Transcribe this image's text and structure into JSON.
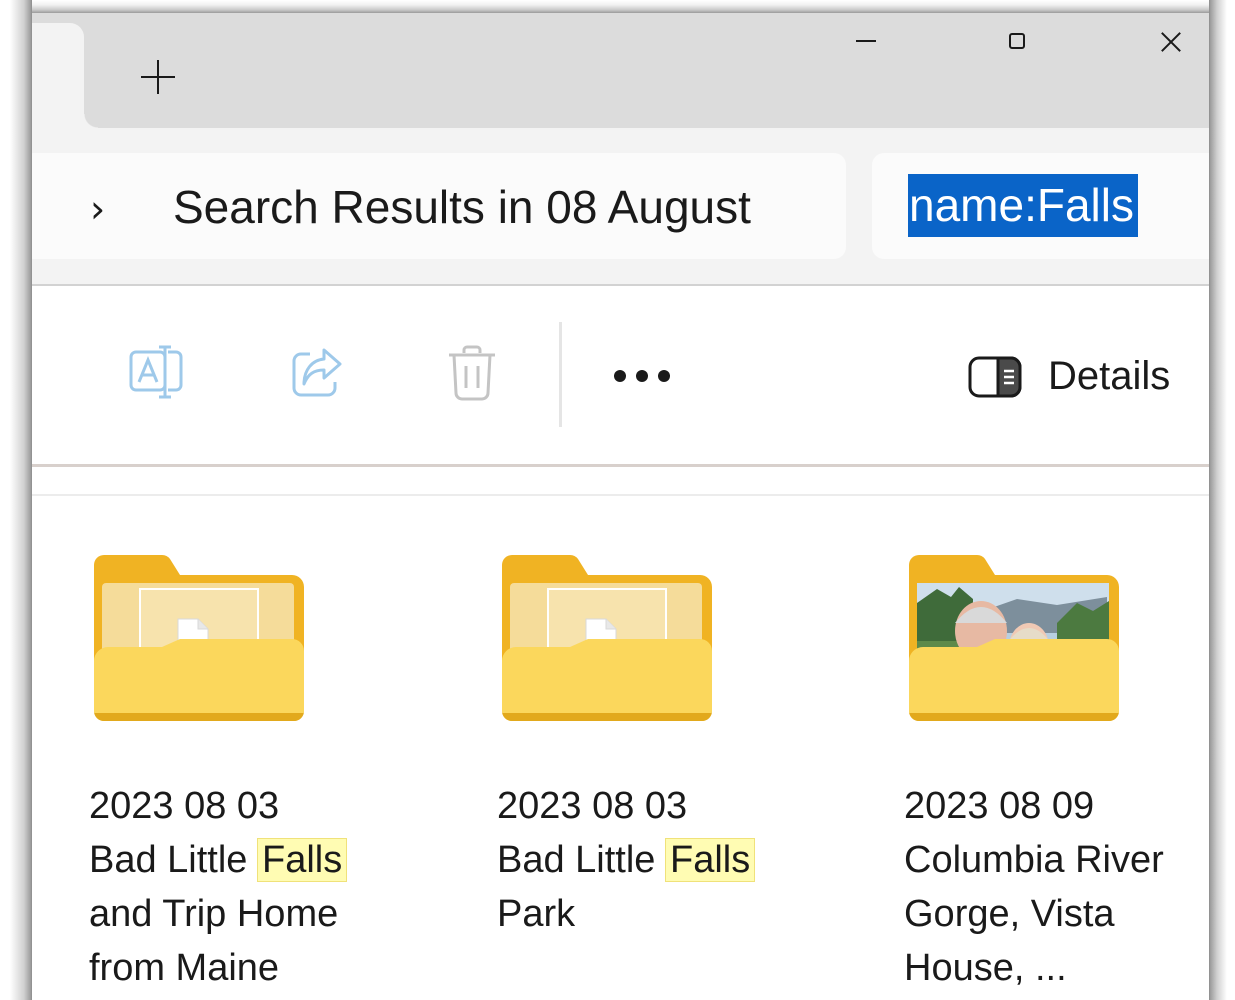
{
  "titlebar": {
    "new_tab_label": "+"
  },
  "address": {
    "chevron": "›",
    "breadcrumb": "Search Results in 08 August",
    "search_query": "name:Falls"
  },
  "commandbar": {
    "rename_icon": "rename-icon",
    "share_icon": "share-icon",
    "delete_icon": "delete-icon",
    "more_icon": "more-options-icon",
    "details_label": "Details",
    "accent_disabled": "#9ec9ea"
  },
  "results": [
    {
      "date": "2023 08 03",
      "name_before": "Bad Little ",
      "match": "Falls",
      "name_after": "and Trip Home from Maine",
      "thumbnail": "document"
    },
    {
      "date": "2023 08 03",
      "name_before": "Bad Little ",
      "match": "Falls",
      "name_after": "Park",
      "thumbnail": "document"
    },
    {
      "date": "2023 08 09",
      "name_before": "",
      "match": "",
      "name_after": "Columbia River Gorge, Vista House, ...",
      "thumbnail": "photo"
    }
  ],
  "colors": {
    "folder_back": "#f0b323",
    "folder_front": "#fbd75c",
    "highlight": "#fffcb3",
    "selection": "#0a64c8"
  }
}
